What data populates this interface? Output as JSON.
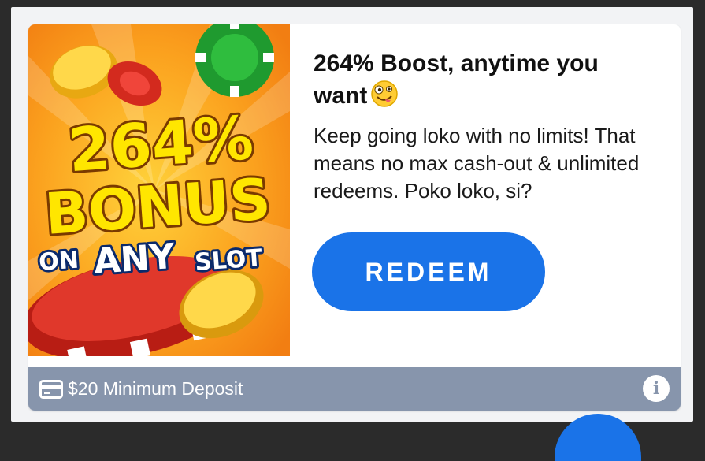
{
  "promo": {
    "image_text": {
      "line1": "264%",
      "line2": "BONUS",
      "line3a": "ON",
      "line3b": "ANY",
      "line3c": "SLOT"
    },
    "title": "264% Boost, anytime you want",
    "title_emoji_icon": "zany-face-emoji",
    "description": "Keep going loko with no limits! That means no max cash-out & unlimited redeems. Poko loko, si?",
    "redeem_label": "REDEEM"
  },
  "footer": {
    "icon": "credit-card-icon",
    "text": "$20 Minimum Deposit",
    "info_icon": "info-icon"
  },
  "colors": {
    "accent_blue": "#1a73e8",
    "footer_bg": "#8795ac",
    "promo_orange": "#f7941d",
    "promo_yellow": "#ffe600"
  }
}
